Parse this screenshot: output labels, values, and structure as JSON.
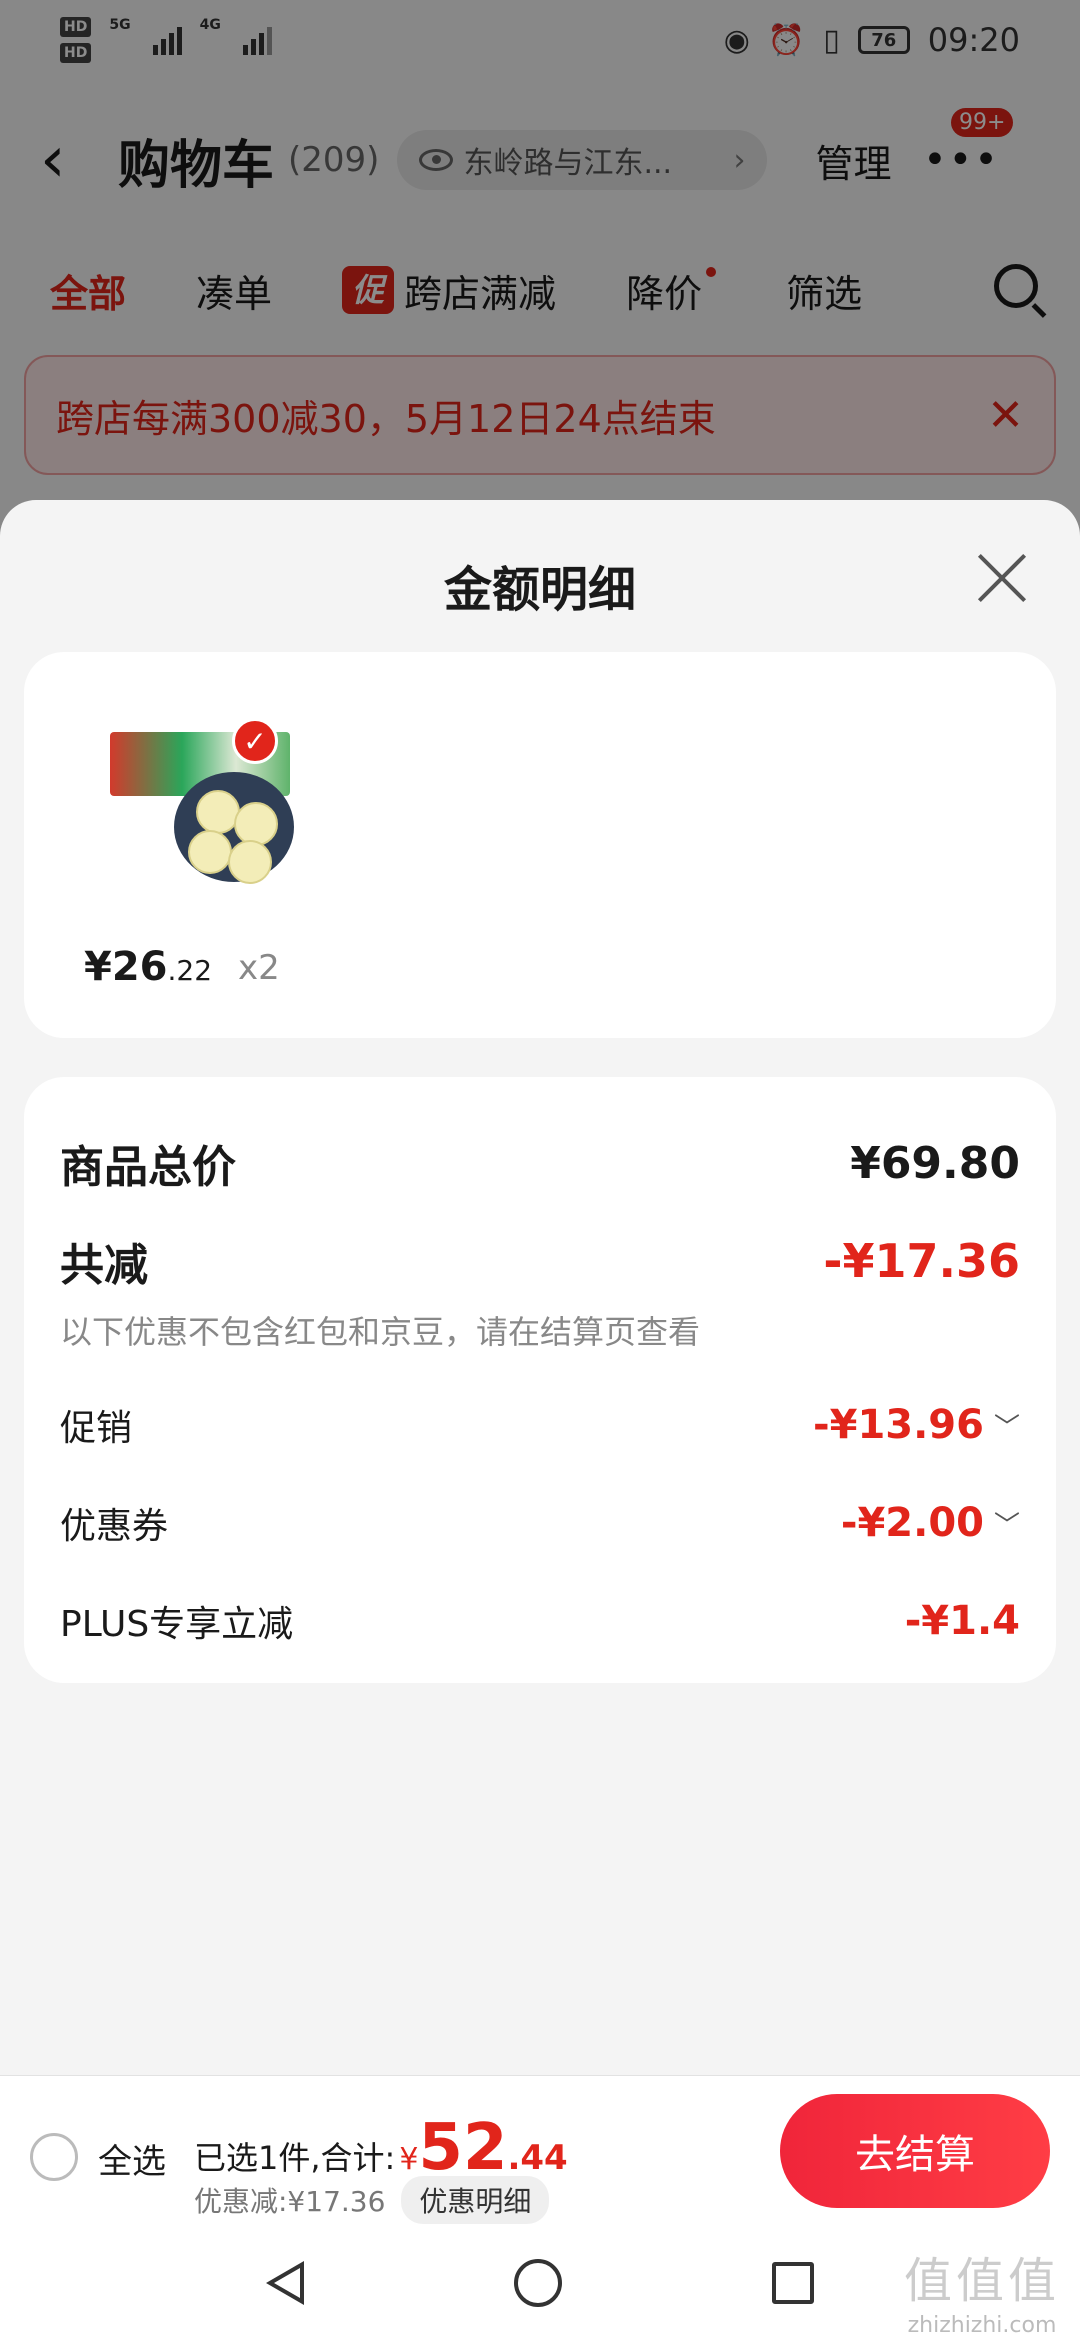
{
  "status_bar": {
    "hd1": "HD",
    "hd2": "HD",
    "sim1_network": "5G",
    "sim2_network": "4G",
    "battery": "76",
    "time": "09:20"
  },
  "header": {
    "title": "购物车",
    "count": "(209)",
    "address": "东岭路与江东...",
    "manage_label": "管理",
    "more_badge": "99+"
  },
  "tabs": [
    {
      "label": "全部",
      "active": true
    },
    {
      "label": "凑单"
    },
    {
      "label": "跨店满减",
      "tag": "促"
    },
    {
      "label": "降价"
    },
    {
      "label": "筛选"
    }
  ],
  "promo_banner": {
    "text": "跨店每满300减30，5月12日24点结束"
  },
  "sheet": {
    "title": "金额明细",
    "product": {
      "price_main": "¥26",
      "price_decimal": ".22",
      "quantity": "x2",
      "selected": true
    },
    "details": {
      "total_label": "商品总价",
      "total_value": "¥69.80",
      "reduce_label": "共减",
      "reduce_value": "-¥17.36",
      "note": "以下优惠不包含红包和京豆，请在结算页查看",
      "promotion_label": "促销",
      "promotion_value": "-¥13.96",
      "coupon_label": "优惠券",
      "coupon_value": "-¥2.00",
      "plus_label": "PLUS专享立减",
      "plus_value": "-¥1.4"
    }
  },
  "checkout_bar": {
    "select_all_label": "全选",
    "summary_prefix": "已选1件,合计:",
    "currency": "¥",
    "total_int": "52",
    "total_dec": ".44",
    "discount_text": "优惠减:¥17.36",
    "detail_chip": "优惠明细",
    "checkout_label": "去结算"
  },
  "watermark": {
    "big": "值值值",
    "small": "zhizhizhi.com"
  },
  "colors": {
    "accent": "#e1251b",
    "checkout_gradient_start": "#f0253a",
    "checkout_gradient_end": "#ff3d45"
  }
}
